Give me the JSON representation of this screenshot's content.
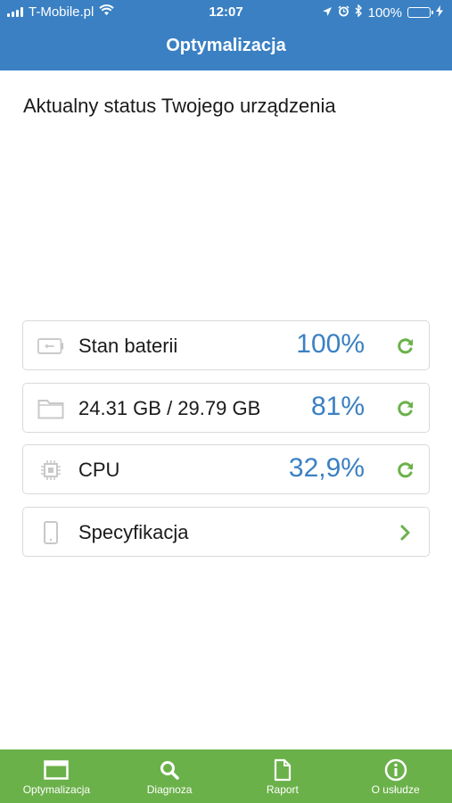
{
  "status_bar": {
    "carrier": "T-Mobile.pl",
    "time": "12:07",
    "battery_percent": "100%",
    "battery_level": 1.0,
    "icons": [
      "signal-icon",
      "wifi-icon",
      "location-icon",
      "alarm-icon",
      "bluetooth-icon",
      "battery-icon",
      "charging-icon"
    ]
  },
  "header": {
    "title": "Optymalizacja"
  },
  "main": {
    "heading": "Aktualny status Twojego urządzenia",
    "cards": [
      {
        "label": "Stan baterii",
        "value": "100%",
        "icon": "battery-icon",
        "action": "refresh-icon"
      },
      {
        "label": "24.31 GB / 29.79 GB",
        "value": "81%",
        "icon": "folder-icon",
        "action": "refresh-icon"
      },
      {
        "label": "CPU",
        "value": "32,9%",
        "icon": "cpu-icon",
        "action": "refresh-icon"
      },
      {
        "label": "Specyfikacja",
        "value": "",
        "icon": "phone-icon",
        "action": "chevron-right-icon"
      }
    ]
  },
  "tabbar": {
    "tabs": [
      {
        "label": "Optymalizacja",
        "icon": "window-icon"
      },
      {
        "label": "Diagnoza",
        "icon": "search-icon"
      },
      {
        "label": "Raport",
        "icon": "document-icon"
      },
      {
        "label": "O usłudze",
        "icon": "info-icon"
      }
    ]
  },
  "colors": {
    "header_bg": "#3a80c3",
    "accent_green": "#6bb14a",
    "value_blue": "#3a80c3"
  }
}
